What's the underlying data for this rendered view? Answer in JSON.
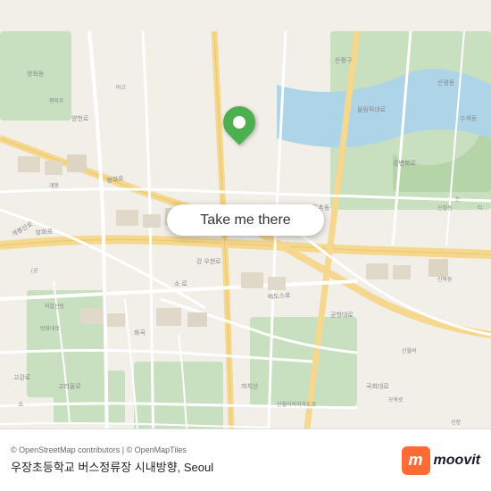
{
  "map": {
    "attribution": "© OpenStreetMap contributors | © OpenMapTiles",
    "location_name": "우장초등학교 버스정류장 시내방향, Seoul",
    "take_me_there_label": "Take me there",
    "pin_color": "#4caf50",
    "center_lat": 37.55,
    "center_lng": 126.87
  },
  "moovit": {
    "logo_text": "moovit",
    "logo_icon": "m",
    "logo_bg_color": "#ff6b35"
  }
}
